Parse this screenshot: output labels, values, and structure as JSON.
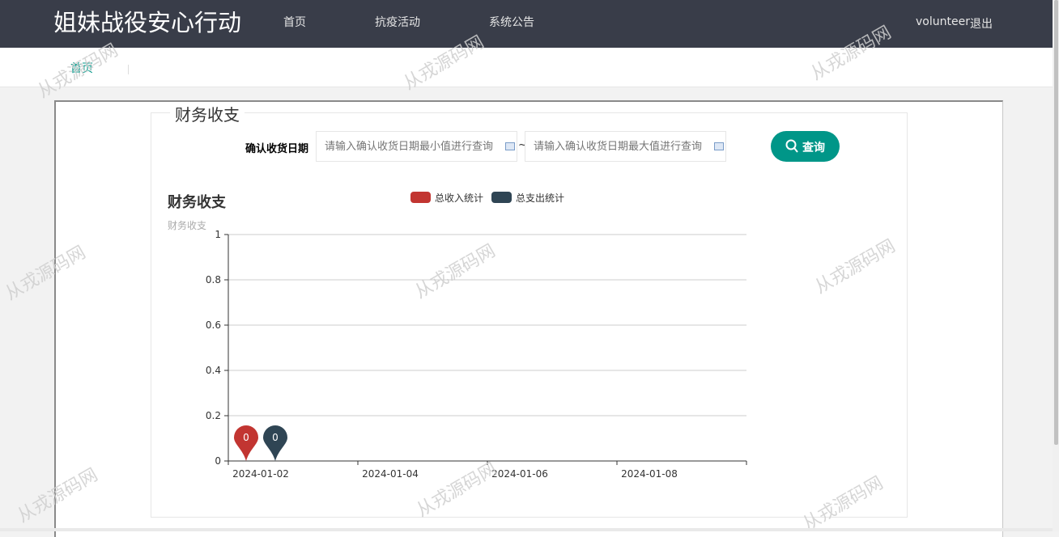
{
  "header": {
    "brand": "姐妹战役安心行动",
    "nav": [
      "首页",
      "抗疫活动",
      "系统公告"
    ],
    "user": "volunteer",
    "logout": "退出"
  },
  "breadcrumb": {
    "home": "首页"
  },
  "panel": {
    "legend": "财务收支",
    "filter_label": "确认收货日期",
    "min_placeholder": "请输入确认收货日期最小值进行查询",
    "max_placeholder": "请输入确认收货日期最大值进行查询",
    "tilde": "~",
    "search_label": "查询"
  },
  "watermark": "从戎源码网",
  "colors": {
    "accent": "#009688",
    "header": "#393d49",
    "income": "#c23531",
    "expense": "#2f4554"
  },
  "chart_data": {
    "type": "line",
    "title": "财务收支",
    "ylabel": "财务收支",
    "ylim": [
      0,
      1
    ],
    "yticks": [
      "0",
      "0.2",
      "0.4",
      "0.6",
      "0.8",
      "1"
    ],
    "xticks": [
      "2024-01-02",
      "2024-01-04",
      "2024-01-06",
      "2024-01-08"
    ],
    "x": [
      "2024-01-02"
    ],
    "series": [
      {
        "name": "总收入统计",
        "values": [
          0
        ],
        "color": "#c23531",
        "marker_label": "0"
      },
      {
        "name": "总支出统计",
        "values": [
          0
        ],
        "color": "#2f4554",
        "marker_label": "0"
      }
    ],
    "legend_position": "top-center",
    "grid": true
  }
}
